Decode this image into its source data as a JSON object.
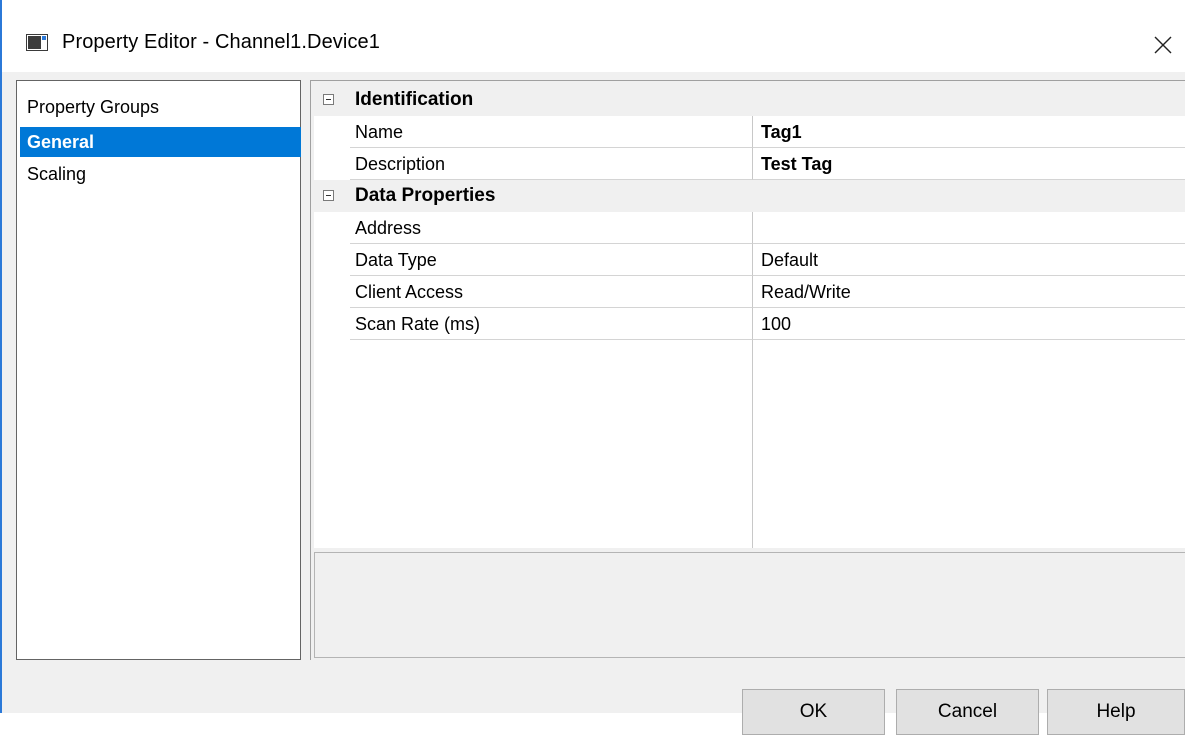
{
  "window": {
    "title": "Property Editor - Channel1.Device1",
    "icon": "app-window-icon",
    "close_icon": "close-icon"
  },
  "property_groups": {
    "header": "Property Groups",
    "items": [
      {
        "label": "General",
        "selected": true
      },
      {
        "label": "Scaling",
        "selected": false
      }
    ]
  },
  "grid": {
    "categories": [
      {
        "label": "Identification",
        "properties": [
          {
            "name": "Name",
            "value": "Tag1",
            "bold": true
          },
          {
            "name": "Description",
            "value": "Test Tag",
            "bold": true
          }
        ]
      },
      {
        "label": "Data Properties",
        "properties": [
          {
            "name": "Address",
            "value": ""
          },
          {
            "name": "Data Type",
            "value": "Default"
          },
          {
            "name": "Client Access",
            "value": "Read/Write"
          },
          {
            "name": "Scan Rate (ms)",
            "value": "100"
          }
        ]
      }
    ]
  },
  "buttons": {
    "ok": "OK",
    "cancel": "Cancel",
    "help": "Help"
  },
  "colors": {
    "selection": "#0078d7",
    "dialog_bg": "#f0f0f0"
  }
}
